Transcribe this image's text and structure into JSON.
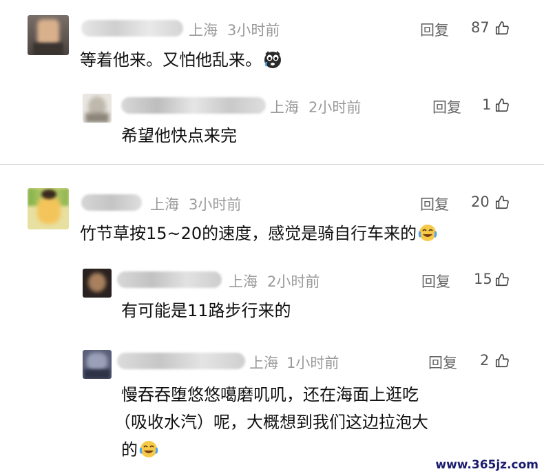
{
  "comments": [
    {
      "location": "上海",
      "time": "3小时前",
      "reply_label": "回复",
      "likes": "87",
      "text": "等着他来。又怕他乱来。",
      "emoji": "scared-face-icon",
      "replies": [
        {
          "location": "上海",
          "time": "2小时前",
          "reply_label": "回复",
          "likes": "1",
          "text": "希望他快点来完"
        }
      ]
    },
    {
      "location": "上海",
      "time": "3小时前",
      "reply_label": "回复",
      "likes": "20",
      "text": "竹节草按15~20的速度，感觉是骑自行车来的",
      "emoji": "laughing-crying-face-icon",
      "replies": [
        {
          "location": "上海",
          "time": "2小时前",
          "reply_label": "回复",
          "likes": "15",
          "text": "有可能是11路步行来的"
        },
        {
          "location": "上海",
          "time": "1小时前",
          "reply_label": "回复",
          "likes": "2",
          "text_lines": [
            "慢吞吞堕悠悠噶磨叽叽，还在海面上逛吃",
            "（吸收水汽）呢，大概想到我们这边拉泡大",
            "的"
          ],
          "emoji": "laughing-crying-face-icon"
        }
      ]
    }
  ],
  "watermark": "www.365jz.com",
  "colors": {
    "meta": "#9a9a9a",
    "text": "#111111",
    "divider": "#cfcfcf"
  }
}
